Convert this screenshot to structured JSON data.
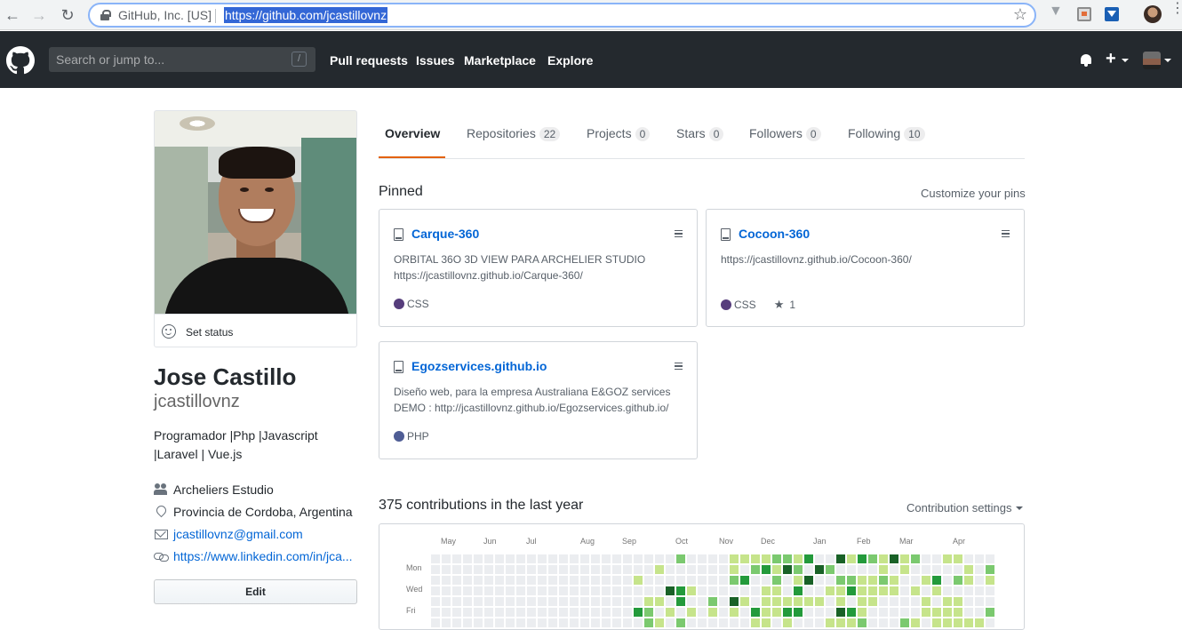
{
  "browser": {
    "site_identity": "GitHub, Inc. [US]",
    "url": "https://github.com/jcastillovnz"
  },
  "header": {
    "search_placeholder": "Search or jump to...",
    "search_shortcut": "/",
    "nav": [
      "Pull requests",
      "Issues",
      "Marketplace",
      "Explore"
    ]
  },
  "profile": {
    "set_status": "Set status",
    "fullname": "Jose Castillo",
    "username": "jcastillovnz",
    "bio": "Programador |Php |Javascript |Laravel | Vue.js",
    "organization": "Archeliers Estudio",
    "location": "Provincia de Cordoba, Argentina",
    "email": "jcastillovnz@gmail.com",
    "website": "https://www.linkedin.com/in/jca...",
    "edit_label": "Edit"
  },
  "tabs": [
    {
      "label": "Overview",
      "count": ""
    },
    {
      "label": "Repositories",
      "count": "22"
    },
    {
      "label": "Projects",
      "count": "0"
    },
    {
      "label": "Stars",
      "count": "0"
    },
    {
      "label": "Followers",
      "count": "0"
    },
    {
      "label": "Following",
      "count": "10"
    }
  ],
  "pinned": {
    "title": "Pinned",
    "customize": "Customize your pins",
    "repos": [
      {
        "name": "Carque-360",
        "desc1": "ORBITAL 36O 3D VIEW PARA ARCHELIER STUDIO",
        "desc2": "https://jcastillovnz.github.io/Carque-360/",
        "language": "CSS",
        "lang_color": "#563d7c",
        "stars": ""
      },
      {
        "name": "Cocoon-360",
        "desc1": "https://jcastillovnz.github.io/Cocoon-360/",
        "desc2": "",
        "language": "CSS",
        "lang_color": "#563d7c",
        "stars": "1"
      },
      {
        "name": "Egozservices.github.io",
        "desc1": "Diseño web, para la empresa Australiana E&GOZ services",
        "desc2": "DEMO : http://jcastillovnz.github.io/Egozservices.github.io/",
        "language": "PHP",
        "lang_color": "#4F5D95",
        "stars": ""
      }
    ]
  },
  "contributions": {
    "title": "375 contributions in the last year",
    "settings": "Contribution settings",
    "months": [
      "May",
      "Jun",
      "Jul",
      "Aug",
      "Sep",
      "Oct",
      "Nov",
      "Dec",
      "Jan",
      "Feb",
      "Mar",
      "Apr"
    ],
    "days": [
      "Mon",
      "Wed",
      "Fri"
    ],
    "levels": [
      "#ebedf0",
      "#c6e48b",
      "#7bc96f",
      "#239a3b",
      "#196127"
    ]
  }
}
